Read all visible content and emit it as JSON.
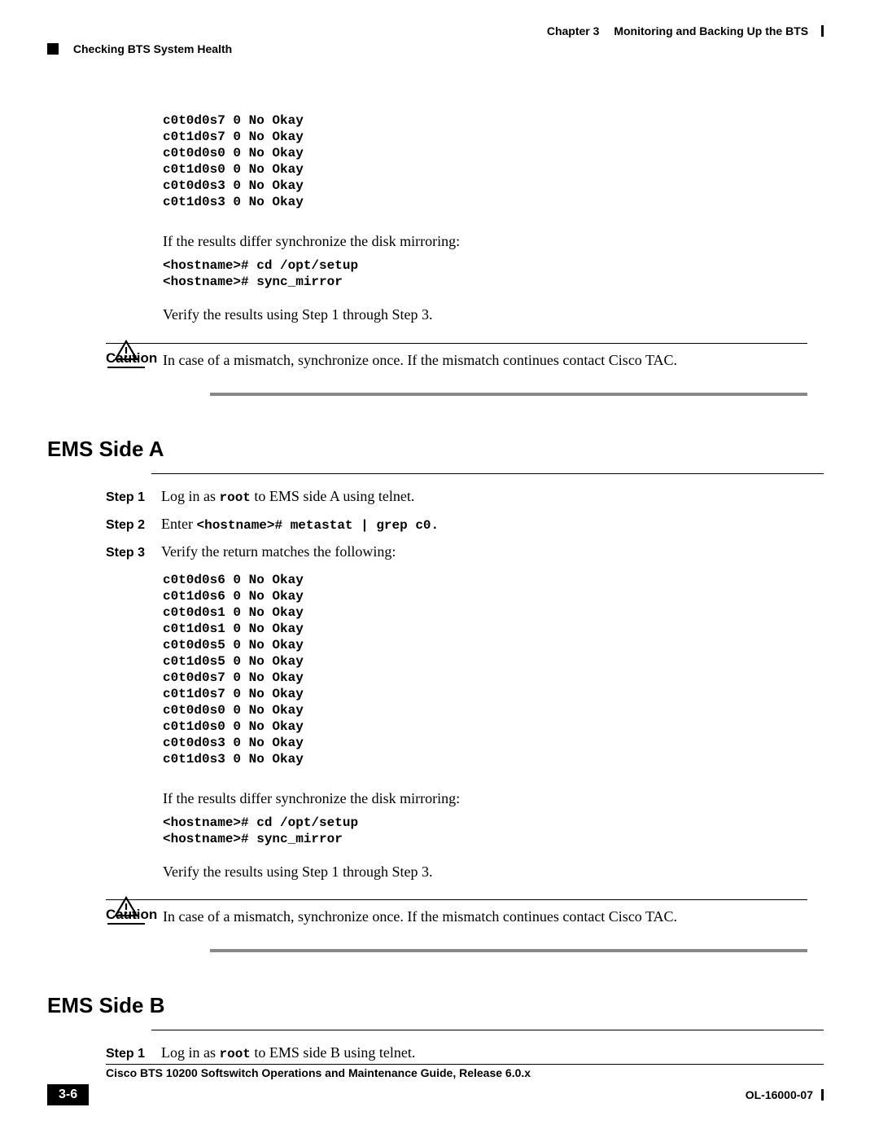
{
  "header": {
    "chapter_label": "Chapter 3",
    "chapter_title": "Monitoring and Backing Up the BTS",
    "section_breadcrumb": "Checking BTS System Health"
  },
  "block1": {
    "output": "c0t0d0s7 0 No Okay\nc0t1d0s7 0 No Okay\nc0t0d0s0 0 No Okay\nc0t1d0s0 0 No Okay\nc0t0d0s3 0 No Okay\nc0t1d0s3 0 No Okay",
    "differ_text": "If the results differ synchronize the disk mirroring:",
    "sync_cmds": "<hostname># cd /opt/setup\n<hostname># sync_mirror",
    "verify_text": "Verify the results using Step 1 through Step 3."
  },
  "caution": {
    "label": "Caution",
    "text": "In case of a mismatch, synchronize once. If the mismatch continues contact Cisco TAC."
  },
  "section_a": {
    "heading": "EMS Side A",
    "step1": {
      "label": "Step 1",
      "pre": "Log in as ",
      "root": "root",
      "post": " to EMS side A using telnet."
    },
    "step2": {
      "label": "Step 2",
      "pre": "Enter ",
      "cmd": "<hostname># metastat | grep c0."
    },
    "step3": {
      "label": "Step 3",
      "text": "Verify the return matches the following:"
    },
    "output": "c0t0d0s6 0 No Okay\nc0t1d0s6 0 No Okay\nc0t0d0s1 0 No Okay\nc0t1d0s1 0 No Okay\nc0t0d0s5 0 No Okay\nc0t1d0s5 0 No Okay\nc0t0d0s7 0 No Okay\nc0t1d0s7 0 No Okay\nc0t0d0s0 0 No Okay\nc0t1d0s0 0 No Okay\nc0t0d0s3 0 No Okay\nc0t1d0s3 0 No Okay",
    "differ_text": "If the results differ synchronize the disk mirroring:",
    "sync_cmds": "<hostname># cd /opt/setup\n<hostname># sync_mirror",
    "verify_text": "Verify the results using Step 1 through Step 3."
  },
  "section_b": {
    "heading": "EMS Side B",
    "step1": {
      "label": "Step 1",
      "pre": "Log in as ",
      "root": "root",
      "post": " to EMS side B using telnet."
    }
  },
  "footer": {
    "guide_title": "Cisco BTS 10200 Softswitch Operations and Maintenance Guide, Release 6.0.x",
    "page_number": "3-6",
    "doc_id": "OL-16000-07"
  }
}
